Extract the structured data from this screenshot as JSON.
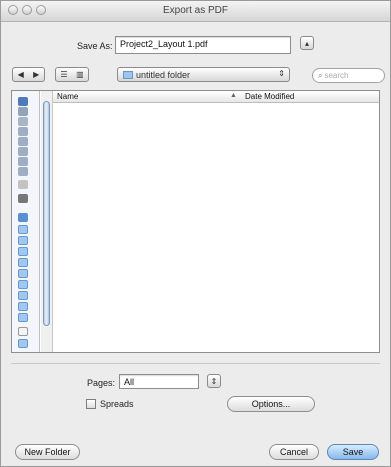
{
  "window": {
    "title": "Export as PDF"
  },
  "save_as": {
    "label": "Save As:",
    "value": "Project2_Layout 1.pdf"
  },
  "toolbar": {
    "location": "untitled folder",
    "search_placeholder": "search"
  },
  "file_list": {
    "columns": [
      "Name",
      "Date Modified"
    ],
    "items": []
  },
  "pages": {
    "label": "Pages:",
    "value": "All"
  },
  "spreads": {
    "label": "Spreads",
    "checked": false
  },
  "buttons": {
    "options": "Options...",
    "new_folder": "New Folder",
    "cancel": "Cancel",
    "save": "Save"
  },
  "icons": {
    "expand": "chevron-up-icon",
    "nav_back": "back-arrow-icon",
    "nav_forward": "forward-arrow-icon",
    "list_view": "list-view-icon",
    "column_view": "column-view-icon",
    "folder": "folder-icon",
    "search": "magnifier-icon",
    "popup": "updown-arrows-icon"
  }
}
